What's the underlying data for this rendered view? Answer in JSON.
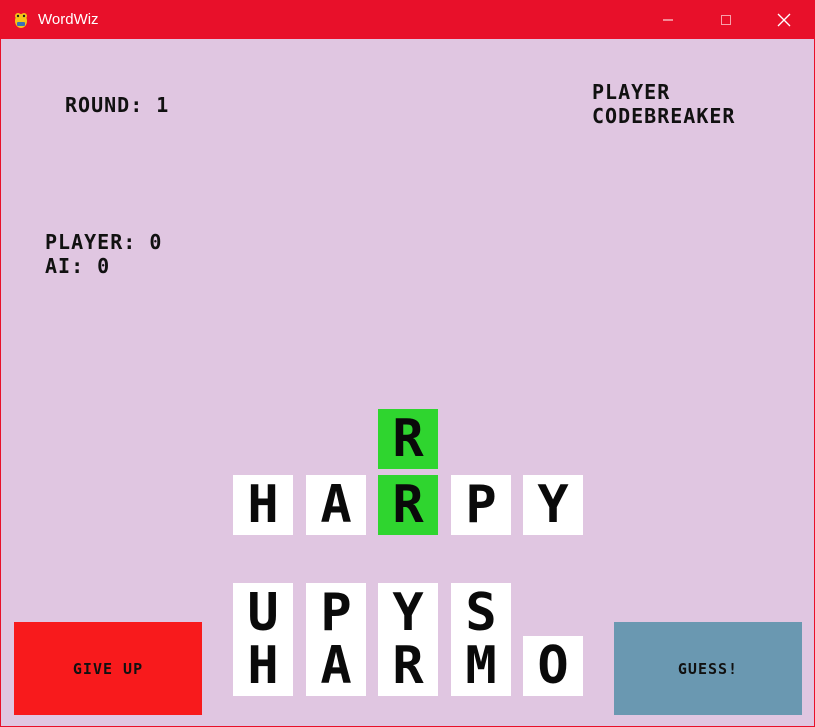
{
  "window": {
    "title": "WordWiz",
    "controls": {
      "minimize": "minimize-icon",
      "maximize": "maximize-icon",
      "close": "close-icon"
    }
  },
  "colors": {
    "titlebar": "#e8102a",
    "background": "#e0c6e1",
    "tile": "#ffffff",
    "tile_correct": "#2fd52f",
    "give_up": "#f81a1c",
    "guess": "#6a98b1"
  },
  "hud": {
    "round": "ROUND: 1",
    "role_line1": "PLAYER",
    "role_line2": "CODEBREAKER",
    "score_player": "PLAYER: 0",
    "score_ai": "AI: 0"
  },
  "board": {
    "hint_tile": {
      "letter": "R",
      "state": "correct"
    },
    "guess_row": [
      {
        "letter": "H",
        "state": "absent"
      },
      {
        "letter": "A",
        "state": "absent"
      },
      {
        "letter": "R",
        "state": "correct"
      },
      {
        "letter": "P",
        "state": "absent"
      },
      {
        "letter": "Y",
        "state": "absent"
      }
    ],
    "letter_bank_row1": [
      "U",
      "P",
      "Y",
      "S"
    ],
    "letter_bank_row2": [
      "H",
      "A",
      "R",
      "M",
      "O"
    ]
  },
  "buttons": {
    "give_up": "GIVE UP",
    "guess": "GUESS!"
  }
}
